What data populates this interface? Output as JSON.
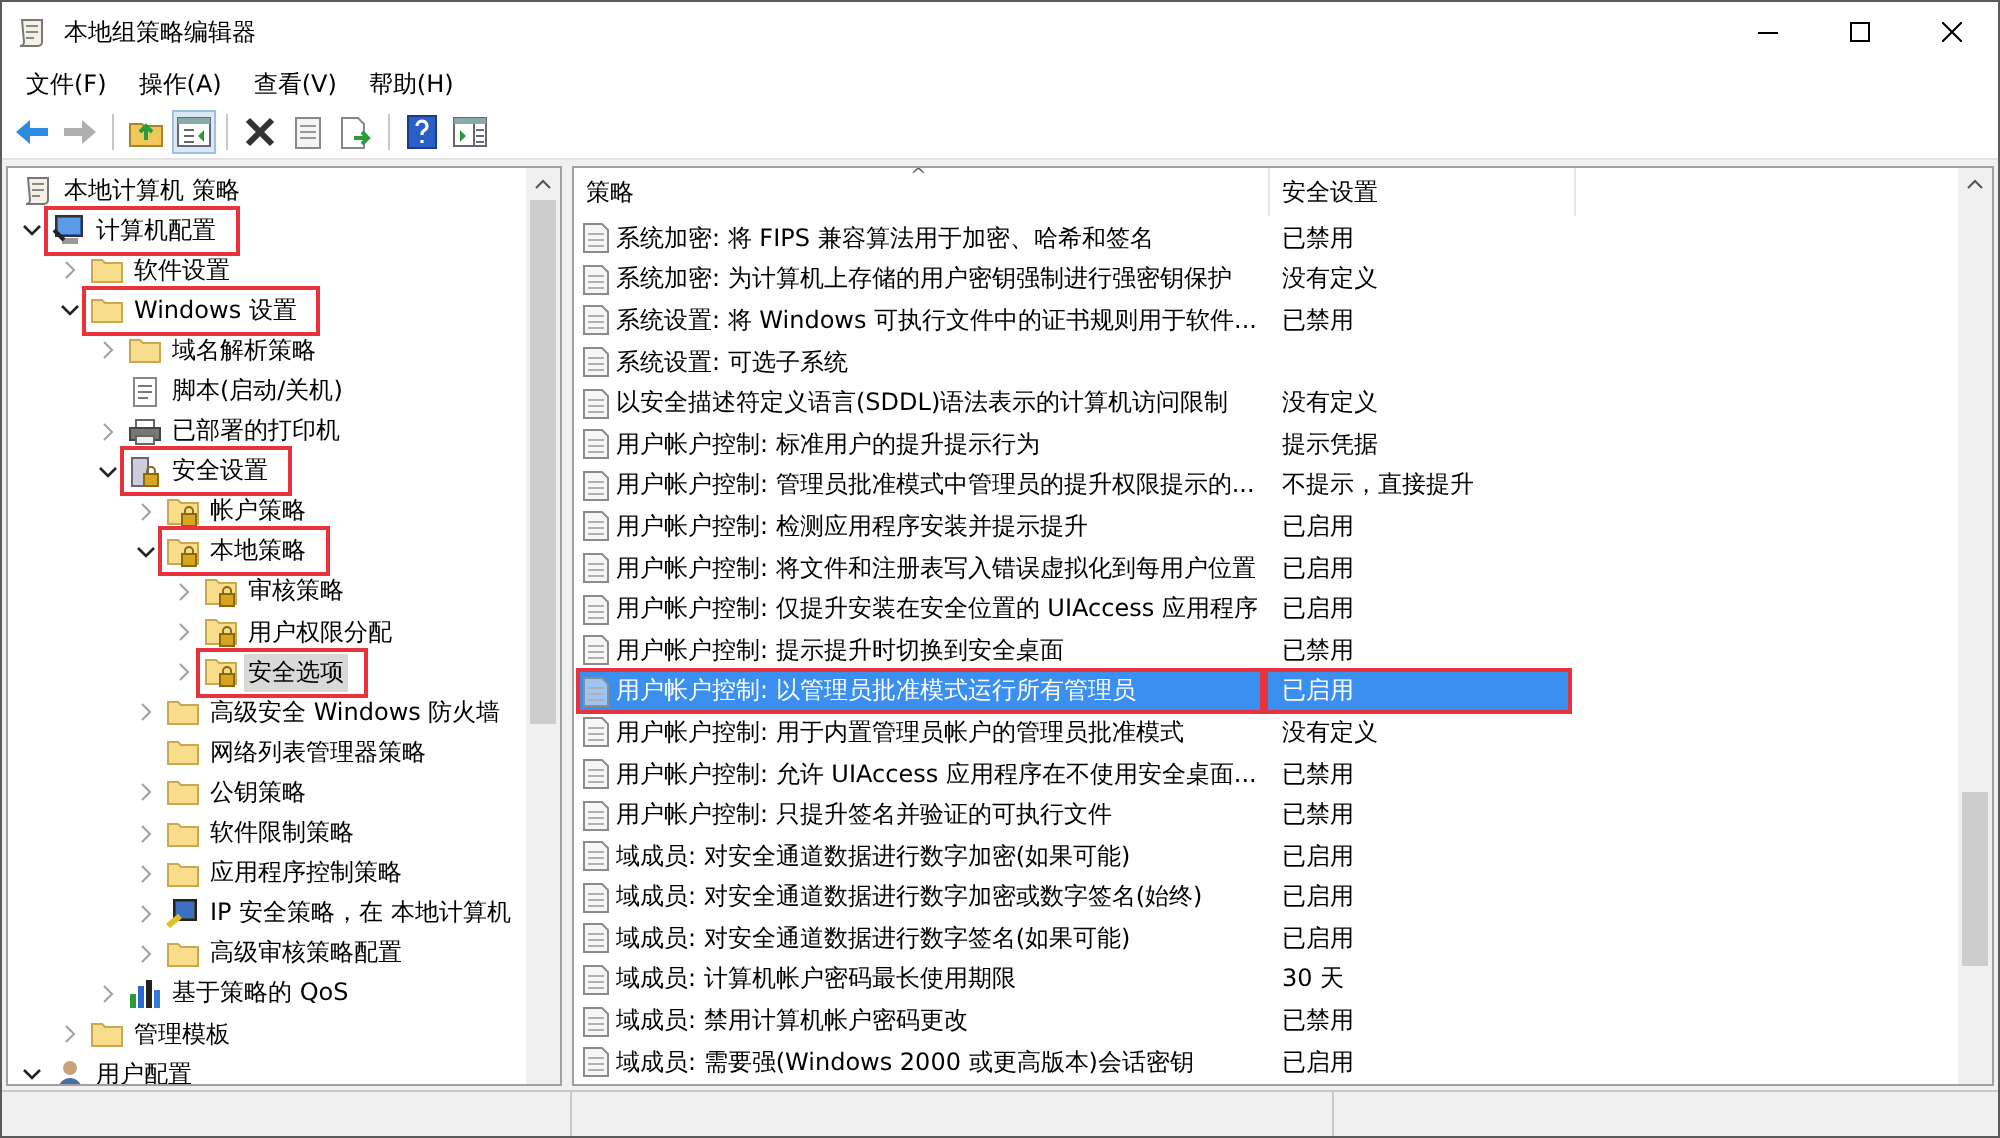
{
  "window": {
    "title": "本地组策略编辑器"
  },
  "menu": [
    "文件(F)",
    "操作(A)",
    "查看(V)",
    "帮助(H)"
  ],
  "toolbar": [
    {
      "kind": "back",
      "disabled": false
    },
    {
      "kind": "forward",
      "disabled": true
    },
    {
      "kind": "separator"
    },
    {
      "kind": "up",
      "disabled": false
    },
    {
      "kind": "tree",
      "disabled": false
    },
    {
      "kind": "separator"
    },
    {
      "kind": "delete",
      "disabled": false
    },
    {
      "kind": "properties",
      "disabled": false
    },
    {
      "kind": "export",
      "disabled": false
    },
    {
      "kind": "separator"
    },
    {
      "kind": "help",
      "disabled": false
    },
    {
      "kind": "pane",
      "disabled": false
    }
  ],
  "tree": {
    "label": "本地计算机 策略",
    "kind": "scroll",
    "children": [
      {
        "label": "计算机配置",
        "kind": "computer",
        "expandable": true,
        "expanded": true,
        "selected": false,
        "annotated": true,
        "children": [
          {
            "label": "软件设置",
            "kind": "folder",
            "expandable": true,
            "expanded": false,
            "selected": false,
            "annotated": false
          },
          {
            "label": "Windows 设置",
            "kind": "folder",
            "expandable": true,
            "expanded": true,
            "selected": false,
            "annotated": true,
            "children": [
              {
                "label": "域名解析策略",
                "kind": "folder",
                "expandable": true,
                "expanded": false,
                "selected": false,
                "annotated": false
              },
              {
                "label": "脚本(启动/关机)",
                "kind": "script",
                "expandable": false,
                "selected": false,
                "annotated": false
              },
              {
                "label": "已部署的打印机",
                "kind": "printer",
                "expandable": true,
                "expanded": false,
                "selected": false,
                "annotated": false
              },
              {
                "label": "安全设置",
                "kind": "security",
                "expandable": true,
                "expanded": true,
                "selected": false,
                "annotated": true,
                "children": [
                  {
                    "label": "帐户策略",
                    "kind": "lockfolder",
                    "expandable": true,
                    "expanded": false,
                    "selected": false,
                    "annotated": false
                  },
                  {
                    "label": "本地策略",
                    "kind": "lockfolder",
                    "expandable": true,
                    "expanded": true,
                    "selected": false,
                    "annotated": true,
                    "children": [
                      {
                        "label": "审核策略",
                        "kind": "lockfolder",
                        "expandable": true,
                        "expanded": false,
                        "selected": false,
                        "annotated": false
                      },
                      {
                        "label": "用户权限分配",
                        "kind": "lockfolder",
                        "expandable": true,
                        "expanded": false,
                        "selected": false,
                        "annotated": false
                      },
                      {
                        "label": "安全选项",
                        "kind": "lockfolder",
                        "expandable": true,
                        "expanded": false,
                        "selected": true,
                        "annotated": true
                      }
                    ]
                  },
                  {
                    "label": "高级安全 Windows 防火墙",
                    "kind": "folder",
                    "expandable": true,
                    "expanded": false,
                    "selected": false,
                    "annotated": false
                  },
                  {
                    "label": "网络列表管理器策略",
                    "kind": "folder",
                    "expandable": false,
                    "selected": false,
                    "annotated": false
                  },
                  {
                    "label": "公钥策略",
                    "kind": "folder",
                    "expandable": true,
                    "expanded": false,
                    "selected": false,
                    "annotated": false
                  },
                  {
                    "label": "软件限制策略",
                    "kind": "folder",
                    "expandable": true,
                    "expanded": false,
                    "selected": false,
                    "annotated": false
                  },
                  {
                    "label": "应用程序控制策略",
                    "kind": "folder",
                    "expandable": true,
                    "expanded": false,
                    "selected": false,
                    "annotated": false
                  },
                  {
                    "label": "IP 安全策略，在 本地计算机",
                    "kind": "ipsec",
                    "expandable": true,
                    "expanded": false,
                    "selected": false,
                    "annotated": false
                  },
                  {
                    "label": "高级审核策略配置",
                    "kind": "folder",
                    "expandable": true,
                    "expanded": false,
                    "selected": false,
                    "annotated": false
                  }
                ]
              },
              {
                "label": "基于策略的 QoS",
                "kind": "chart",
                "expandable": true,
                "expanded": false,
                "selected": false,
                "annotated": false
              }
            ]
          },
          {
            "label": "管理模板",
            "kind": "folder",
            "expandable": true,
            "expanded": false,
            "selected": false,
            "annotated": false
          }
        ]
      },
      {
        "label": "用户配置",
        "kind": "user",
        "expandable": true,
        "expanded": true,
        "selected": false,
        "annotated": false
      }
    ]
  },
  "list": {
    "columns": [
      {
        "label": "策略",
        "sorted": true
      },
      {
        "label": "安全设置",
        "sorted": false
      }
    ],
    "sort_indicator": "^",
    "rows": [
      {
        "policy": "系统加密: 将 FIPS 兼容算法用于加密、哈希和签名",
        "setting": "已禁用",
        "selected": false,
        "annotated": false
      },
      {
        "policy": "系统加密: 为计算机上存储的用户密钥强制进行强密钥保护",
        "setting": "没有定义",
        "selected": false,
        "annotated": false
      },
      {
        "policy": "系统设置: 将 Windows 可执行文件中的证书规则用于软件...",
        "setting": "已禁用",
        "selected": false,
        "annotated": false
      },
      {
        "policy": "系统设置: 可选子系统",
        "selected": false,
        "annotated": false
      },
      {
        "policy": "以安全描述符定义语言(SDDL)语法表示的计算机访问限制",
        "setting": "没有定义",
        "selected": false,
        "annotated": false
      },
      {
        "policy": "用户帐户控制: 标准用户的提升提示行为",
        "setting": "提示凭据",
        "selected": false,
        "annotated": false
      },
      {
        "policy": "用户帐户控制: 管理员批准模式中管理员的提升权限提示的...",
        "setting": "不提示，直接提升",
        "selected": false,
        "annotated": false
      },
      {
        "policy": "用户帐户控制: 检测应用程序安装并提示提升",
        "setting": "已启用",
        "selected": false,
        "annotated": false
      },
      {
        "policy": "用户帐户控制: 将文件和注册表写入错误虚拟化到每用户位置",
        "setting": "已启用",
        "selected": false,
        "annotated": false
      },
      {
        "policy": "用户帐户控制: 仅提升安装在安全位置的 UIAccess 应用程序",
        "setting": "已启用",
        "selected": false,
        "annotated": false
      },
      {
        "policy": "用户帐户控制: 提示提升时切换到安全桌面",
        "setting": "已禁用",
        "selected": false,
        "annotated": false
      },
      {
        "policy": "用户帐户控制: 以管理员批准模式运行所有管理员",
        "setting": "已启用",
        "selected": true,
        "annotated": true
      },
      {
        "policy": "用户帐户控制: 用于内置管理员帐户的管理员批准模式",
        "setting": "没有定义",
        "selected": false,
        "annotated": false
      },
      {
        "policy": "用户帐户控制: 允许 UIAccess 应用程序在不使用安全桌面...",
        "setting": "已禁用",
        "selected": false,
        "annotated": false
      },
      {
        "policy": "用户帐户控制: 只提升签名并验证的可执行文件",
        "setting": "已禁用",
        "selected": false,
        "annotated": false
      },
      {
        "policy": "域成员: 对安全通道数据进行数字加密(如果可能)",
        "setting": "已启用",
        "selected": false,
        "annotated": false
      },
      {
        "policy": "域成员: 对安全通道数据进行数字加密或数字签名(始终)",
        "setting": "已启用",
        "selected": false,
        "annotated": false
      },
      {
        "policy": "域成员: 对安全通道数据进行数字签名(如果可能)",
        "setting": "已启用",
        "selected": false,
        "annotated": false
      },
      {
        "policy": "域成员: 计算机帐户密码最长使用期限",
        "setting": "30 天",
        "selected": false,
        "annotated": false
      },
      {
        "policy": "域成员: 禁用计算机帐户密码更改",
        "setting": "已禁用",
        "selected": false,
        "annotated": false
      },
      {
        "policy": "域成员: 需要强(Windows 2000 或更高版本)会话密钥",
        "setting": "已启用",
        "selected": false,
        "annotated": false
      }
    ]
  }
}
